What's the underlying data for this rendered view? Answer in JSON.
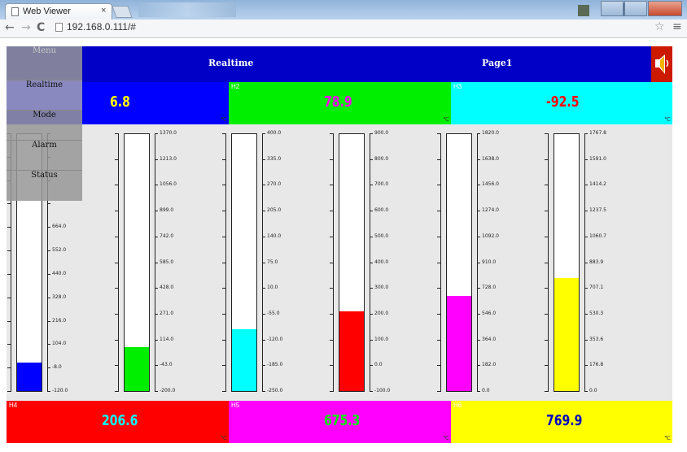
{
  "browser": {
    "tab_title": "Web Viewer",
    "tab_close": "×",
    "back": "←",
    "forward": "→",
    "reload": "C",
    "url": "192.168.0.111/#",
    "star": "☆",
    "menu": "≡"
  },
  "app": {
    "header": {
      "realtime": "Realtime",
      "page": "Page1"
    },
    "menu": {
      "head": "Menu",
      "items": [
        "Realtime",
        "Mode",
        "Alarm",
        "Status"
      ]
    },
    "unit": "℃",
    "top_values": [
      {
        "label": "",
        "value": "6.8",
        "bg": "#0000ff",
        "color": "#ffff00"
      },
      {
        "label": "H2",
        "value": "78.9",
        "bg": "#00ee00",
        "color": "#ff00ff"
      },
      {
        "label": "H3",
        "value": "-92.5",
        "bg": "#00ffff",
        "color": "#ff0000"
      }
    ],
    "bottom_values": [
      {
        "label": "H4",
        "value": "206.6",
        "bg": "#ff0000",
        "color": "#00ffff"
      },
      {
        "label": "H5",
        "value": "675.3",
        "bg": "#ff00ff",
        "color": "#00ee00"
      },
      {
        "label": "H6",
        "value": "769.9",
        "bg": "#ffff00",
        "color": "#0000c0"
      }
    ],
    "gauges": [
      {
        "fill": "#0000ff",
        "level": 0.11,
        "ticks": [
          "",
          "",
          "",
          "",
          "664.0",
          "552.0",
          "440.0",
          "328.0",
          "216.0",
          "104.0",
          "-8.0",
          "-120.0"
        ]
      },
      {
        "fill": "#00ee00",
        "level": 0.17,
        "ticks": [
          "1370.0",
          "1213.0",
          "1056.0",
          "899.0",
          "742.0",
          "585.0",
          "428.0",
          "271.0",
          "114.0",
          "-43.0",
          "-200.0"
        ]
      },
      {
        "fill": "#00ffff",
        "level": 0.24,
        "ticks": [
          "400.0",
          "335.0",
          "270.0",
          "205.0",
          "140.0",
          "75.0",
          "10.0",
          "-55.0",
          "-120.0",
          "-185.0",
          "-250.0"
        ]
      },
      {
        "fill": "#ff0000",
        "level": 0.31,
        "ticks": [
          "900.0",
          "800.0",
          "700.0",
          "600.0",
          "500.0",
          "400.0",
          "300.0",
          "200.0",
          "100.0",
          "0.0",
          "-100.0"
        ]
      },
      {
        "fill": "#ff00ff",
        "level": 0.37,
        "ticks": [
          "1820.0",
          "1638.0",
          "1456.0",
          "1274.0",
          "1092.0",
          "910.0",
          "728.0",
          "546.0",
          "364.0",
          "182.0",
          "0.0"
        ]
      },
      {
        "fill": "#ffff00",
        "level": 0.44,
        "ticks": [
          "1767.8",
          "1591.0",
          "1414.2",
          "1237.5",
          "1060.7",
          "883.9",
          "707.1",
          "530.3",
          "353.6",
          "176.8",
          "0.0"
        ]
      }
    ]
  }
}
